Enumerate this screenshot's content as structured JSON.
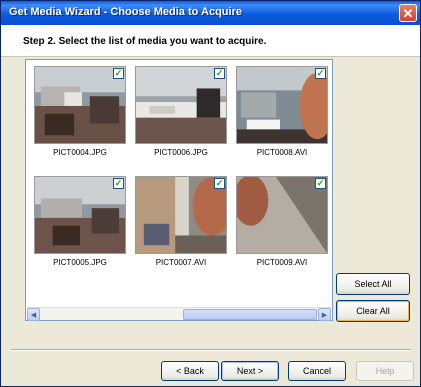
{
  "window": {
    "title": "Get Media Wizard - Choose Media to Acquire",
    "close_glyph": "✕"
  },
  "step": {
    "label": "Step 2. Select the list of media you want to acquire."
  },
  "media": [
    {
      "filename": "PICT0004.JPG",
      "checked": true,
      "check_glyph": "✓"
    },
    {
      "filename": "PICT0006.JPG",
      "checked": true,
      "check_glyph": "✓"
    },
    {
      "filename": "PICT0008.AVI",
      "checked": true,
      "check_glyph": "✓"
    },
    {
      "filename": "PICT0005.JPG",
      "checked": true,
      "check_glyph": "✓"
    },
    {
      "filename": "PICT0007.AVI",
      "checked": true,
      "check_glyph": "✓"
    },
    {
      "filename": "PICT0009.AVI",
      "checked": true,
      "check_glyph": "✓"
    }
  ],
  "scrollbar": {
    "left_arrow": "◀",
    "right_arrow": "▶"
  },
  "side_buttons": {
    "select_all": "Select All",
    "clear_all": "Clear All"
  },
  "nav_buttons": {
    "back": "< Back",
    "next": "Next >",
    "cancel": "Cancel",
    "help": "Help"
  },
  "colors": {
    "titlebar": "#0a5ee8",
    "window_bg": "#ece9d8",
    "check": "#21a121"
  }
}
